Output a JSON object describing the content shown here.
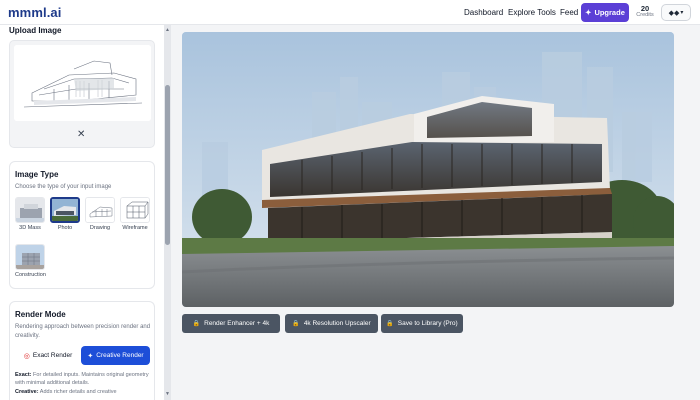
{
  "app": {
    "logo": "mmml.ai"
  },
  "nav": {
    "dashboard": "Dashboard",
    "explore_tools": "Explore Tools",
    "feed": "Feed",
    "upgrade": "Upgrade",
    "credits_count": "20",
    "credits_label": "Credits",
    "user_menu_icon": "diamond-menu-icon"
  },
  "sidebar": {
    "upload_title": "Upload Image",
    "remove_icon": "close-icon",
    "image_type": {
      "title": "Image Type",
      "description": "Choose the type of your input image",
      "options": [
        {
          "label": "3D Mass"
        },
        {
          "label": "Photo"
        },
        {
          "label": "Drawing"
        },
        {
          "label": "Wireframe"
        },
        {
          "label": "Construction"
        }
      ],
      "selected": "Photo"
    },
    "render_mode": {
      "title": "Render Mode",
      "description": "Rendering approach between precision render and creativity.",
      "exact_label": "Exact Render",
      "creative_label": "Creative Render",
      "selected": "Creative Render",
      "exact_note_label": "Exact:",
      "exact_note": "For detailed inputs. Maintains original geometry with minimal additional details.",
      "creative_note_label": "Creative:",
      "creative_note": "Adds richer details and creative"
    }
  },
  "actions": {
    "enhancer": "Render Enhancer + 4k",
    "upscaler": "4k Resolution Upscaler",
    "save": "Save to Library (Pro)"
  },
  "colors": {
    "brand": "#1e3a8a",
    "upgrade": "#5b3fd6",
    "creative": "#1d4ed8",
    "action": "#4b5563"
  }
}
